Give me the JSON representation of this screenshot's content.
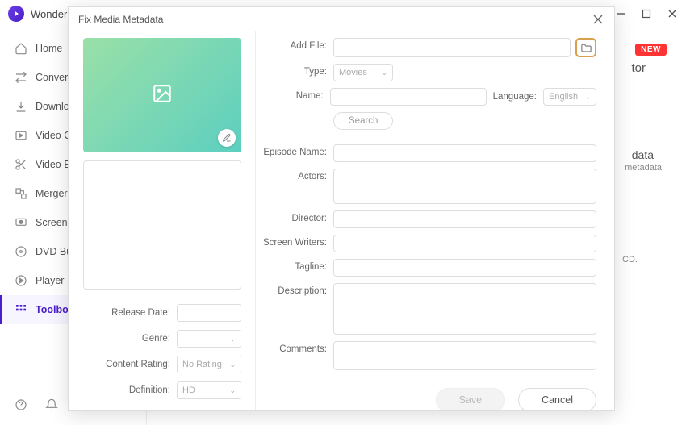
{
  "app": {
    "name": "Wonder"
  },
  "window": {
    "min": "—",
    "max": "☐",
    "close": "✕"
  },
  "sidebar": {
    "items": [
      {
        "label": "Home"
      },
      {
        "label": "Converter"
      },
      {
        "label": "Download"
      },
      {
        "label": "Video Compressor"
      },
      {
        "label": "Video Editor"
      },
      {
        "label": "Merger"
      },
      {
        "label": "Screen Recorder"
      },
      {
        "label": "DVD Burner"
      },
      {
        "label": "Player"
      },
      {
        "label": "Toolbox"
      }
    ]
  },
  "bg": {
    "badge": "NEW",
    "title": "tor",
    "sub1": "data",
    "sub2": "metadata",
    "text": "CD."
  },
  "modal": {
    "title": "Fix Media Metadata",
    "left": {
      "release_date_label": "Release Date:",
      "genre_label": "Genre:",
      "content_rating_label": "Content Rating:",
      "definition_label": "Definition:",
      "release_date": "",
      "genre": "",
      "content_rating": "No Rating",
      "definition": "HD"
    },
    "right": {
      "add_file_label": "Add File:",
      "type_label": "Type:",
      "type": "Movies",
      "name_label": "Name:",
      "name": "",
      "language_label": "Language:",
      "language": "English",
      "search_btn": "Search",
      "episode_label": "Episode Name:",
      "episode": "",
      "actors_label": "Actors:",
      "actors": "",
      "director_label": "Director:",
      "director": "",
      "writers_label": "Screen Writers:",
      "writers": "",
      "tagline_label": "Tagline:",
      "tagline": "",
      "description_label": "Description:",
      "description": "",
      "comments_label": "Comments:",
      "comments": ""
    },
    "buttons": {
      "save": "Save",
      "cancel": "Cancel"
    }
  }
}
